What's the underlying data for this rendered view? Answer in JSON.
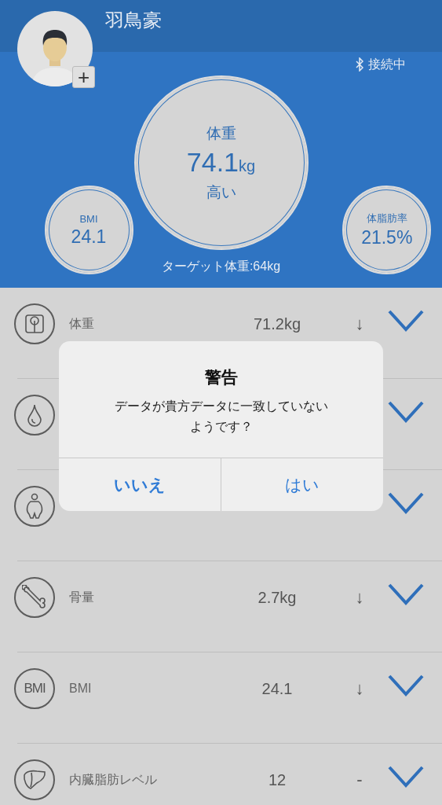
{
  "profile": {
    "name": "羽鳥豪",
    "add_button": "+"
  },
  "connection": {
    "status": "接続中"
  },
  "main_metric": {
    "label": "体重",
    "value": "74.1",
    "unit": "kg",
    "status": "高い"
  },
  "side_metrics": [
    {
      "label": "BMI",
      "value": "24.1"
    },
    {
      "label": "体脂肪率",
      "value": "21.5%"
    }
  ],
  "target": "ターゲット体重:64kg",
  "rows": [
    {
      "kind": "scale",
      "label": "体重",
      "value": "71.2kg",
      "trend": "↓"
    },
    {
      "kind": "drop"
    },
    {
      "kind": "body"
    },
    {
      "kind": "bone",
      "label": "骨量",
      "value": "2.7kg",
      "trend": "↓"
    },
    {
      "kind": "bmi",
      "icon_label": "BMI",
      "label": "BMI",
      "value": "24.1",
      "trend": "↓"
    },
    {
      "kind": "liver",
      "label": "内臓脂肪レベル",
      "value": "12",
      "trend": "-"
    }
  ],
  "dialog": {
    "title": "警告",
    "message_lines": [
      "データが貴方データに一致していない",
      "ようです？"
    ],
    "buttons": [
      {
        "label": "いいえ",
        "kind": "cancel"
      },
      {
        "label": "はい",
        "kind": "default"
      }
    ]
  }
}
